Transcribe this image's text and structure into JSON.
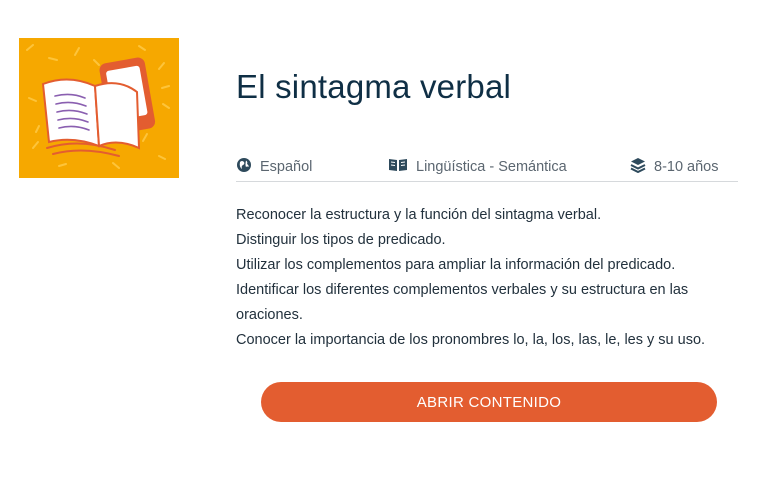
{
  "course": {
    "title": "El sintagma verbal",
    "thumbnail_icon": "book-tablet-illustration-icon"
  },
  "meta": {
    "language": "Español",
    "area": "Lingüística - Semántica",
    "age": "8-10 años"
  },
  "objectives": [
    "Reconocer la estructura y la función del sintagma verbal.",
    "Distinguir los tipos de predicado.",
    "Utilizar los complementos para ampliar la información del predicado.",
    "Identificar los diferentes complementos verbales y su estructura en las",
    "oraciones.",
    "Conocer la importancia de los pronombres lo, la, los, las, le, les y su uso."
  ],
  "actions": {
    "open_label": "ABRIR CONTENIDO"
  },
  "colors": {
    "thumbnail_bg": "#f6a800",
    "accent": "#e35d30",
    "title": "#0f2f45"
  }
}
